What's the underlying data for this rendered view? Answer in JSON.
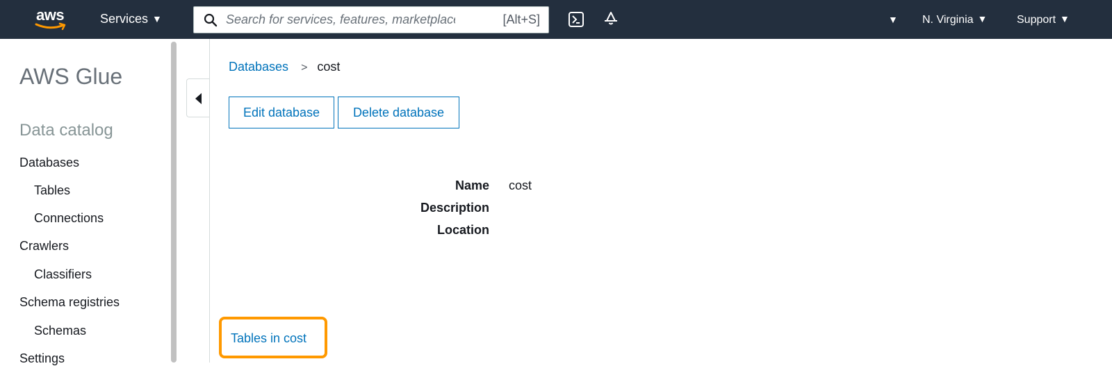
{
  "topbar": {
    "logo_text": "aws",
    "services_label": "Services",
    "search_placeholder": "Search for services, features, marketplace pi",
    "search_shortcut": "[Alt+S]",
    "region_label": "N. Virginia",
    "support_label": "Support",
    "icons": [
      "search-icon",
      "cloudshell-icon",
      "bell-icon",
      "caret-down-icon"
    ]
  },
  "sidebar": {
    "title": "AWS Glue",
    "section": "Data catalog",
    "items": [
      {
        "label": "Databases"
      },
      {
        "label": "Tables"
      },
      {
        "label": "Connections"
      },
      {
        "label": "Crawlers"
      },
      {
        "label": "Classifiers"
      },
      {
        "label": "Schema registries"
      },
      {
        "label": "Schemas"
      },
      {
        "label": "Settings"
      }
    ]
  },
  "breadcrumb": {
    "parent": "Databases",
    "current": "cost"
  },
  "actions": {
    "edit_label": "Edit database",
    "delete_label": "Delete database"
  },
  "details": {
    "name_label": "Name",
    "name_value": "cost",
    "description_label": "Description",
    "description_value": "",
    "location_label": "Location",
    "location_value": ""
  },
  "tables_link": "Tables in cost",
  "colors": {
    "topbar_bg": "#232f3e",
    "link": "#0073bb",
    "highlight": "#ff9900"
  }
}
